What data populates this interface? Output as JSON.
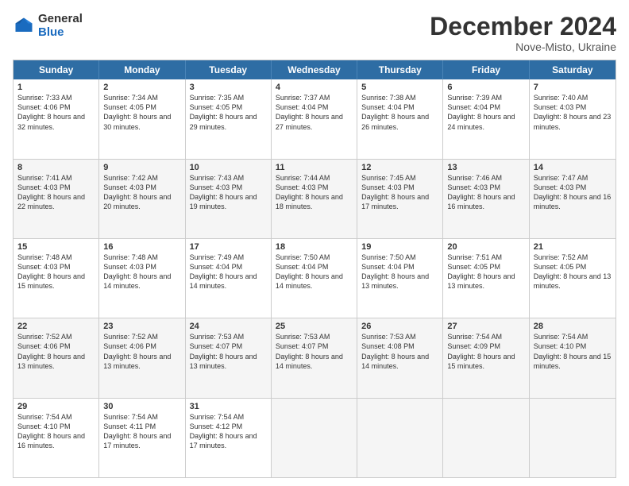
{
  "logo": {
    "general": "General",
    "blue": "Blue"
  },
  "title": "December 2024",
  "subtitle": "Nove-Misto, Ukraine",
  "days": [
    "Sunday",
    "Monday",
    "Tuesday",
    "Wednesday",
    "Thursday",
    "Friday",
    "Saturday"
  ],
  "weeks": [
    [
      {
        "day": 1,
        "rise": "7:33 AM",
        "set": "4:06 PM",
        "daylight": "8 hours and 32 minutes."
      },
      {
        "day": 2,
        "rise": "7:34 AM",
        "set": "4:05 PM",
        "daylight": "8 hours and 30 minutes."
      },
      {
        "day": 3,
        "rise": "7:35 AM",
        "set": "4:05 PM",
        "daylight": "8 hours and 29 minutes."
      },
      {
        "day": 4,
        "rise": "7:37 AM",
        "set": "4:04 PM",
        "daylight": "8 hours and 27 minutes."
      },
      {
        "day": 5,
        "rise": "7:38 AM",
        "set": "4:04 PM",
        "daylight": "8 hours and 26 minutes."
      },
      {
        "day": 6,
        "rise": "7:39 AM",
        "set": "4:04 PM",
        "daylight": "8 hours and 24 minutes."
      },
      {
        "day": 7,
        "rise": "7:40 AM",
        "set": "4:03 PM",
        "daylight": "8 hours and 23 minutes."
      }
    ],
    [
      {
        "day": 8,
        "rise": "7:41 AM",
        "set": "4:03 PM",
        "daylight": "8 hours and 22 minutes."
      },
      {
        "day": 9,
        "rise": "7:42 AM",
        "set": "4:03 PM",
        "daylight": "8 hours and 20 minutes."
      },
      {
        "day": 10,
        "rise": "7:43 AM",
        "set": "4:03 PM",
        "daylight": "8 hours and 19 minutes."
      },
      {
        "day": 11,
        "rise": "7:44 AM",
        "set": "4:03 PM",
        "daylight": "8 hours and 18 minutes."
      },
      {
        "day": 12,
        "rise": "7:45 AM",
        "set": "4:03 PM",
        "daylight": "8 hours and 17 minutes."
      },
      {
        "day": 13,
        "rise": "7:46 AM",
        "set": "4:03 PM",
        "daylight": "8 hours and 16 minutes."
      },
      {
        "day": 14,
        "rise": "7:47 AM",
        "set": "4:03 PM",
        "daylight": "8 hours and 16 minutes."
      }
    ],
    [
      {
        "day": 15,
        "rise": "7:48 AM",
        "set": "4:03 PM",
        "daylight": "8 hours and 15 minutes."
      },
      {
        "day": 16,
        "rise": "7:48 AM",
        "set": "4:03 PM",
        "daylight": "8 hours and 14 minutes."
      },
      {
        "day": 17,
        "rise": "7:49 AM",
        "set": "4:04 PM",
        "daylight": "8 hours and 14 minutes."
      },
      {
        "day": 18,
        "rise": "7:50 AM",
        "set": "4:04 PM",
        "daylight": "8 hours and 14 minutes."
      },
      {
        "day": 19,
        "rise": "7:50 AM",
        "set": "4:04 PM",
        "daylight": "8 hours and 13 minutes."
      },
      {
        "day": 20,
        "rise": "7:51 AM",
        "set": "4:05 PM",
        "daylight": "8 hours and 13 minutes."
      },
      {
        "day": 21,
        "rise": "7:52 AM",
        "set": "4:05 PM",
        "daylight": "8 hours and 13 minutes."
      }
    ],
    [
      {
        "day": 22,
        "rise": "7:52 AM",
        "set": "4:06 PM",
        "daylight": "8 hours and 13 minutes."
      },
      {
        "day": 23,
        "rise": "7:52 AM",
        "set": "4:06 PM",
        "daylight": "8 hours and 13 minutes."
      },
      {
        "day": 24,
        "rise": "7:53 AM",
        "set": "4:07 PM",
        "daylight": "8 hours and 13 minutes."
      },
      {
        "day": 25,
        "rise": "7:53 AM",
        "set": "4:07 PM",
        "daylight": "8 hours and 14 minutes."
      },
      {
        "day": 26,
        "rise": "7:53 AM",
        "set": "4:08 PM",
        "daylight": "8 hours and 14 minutes."
      },
      {
        "day": 27,
        "rise": "7:54 AM",
        "set": "4:09 PM",
        "daylight": "8 hours and 15 minutes."
      },
      {
        "day": 28,
        "rise": "7:54 AM",
        "set": "4:10 PM",
        "daylight": "8 hours and 15 minutes."
      }
    ],
    [
      {
        "day": 29,
        "rise": "7:54 AM",
        "set": "4:10 PM",
        "daylight": "8 hours and 16 minutes."
      },
      {
        "day": 30,
        "rise": "7:54 AM",
        "set": "4:11 PM",
        "daylight": "8 hours and 17 minutes."
      },
      {
        "day": 31,
        "rise": "7:54 AM",
        "set": "4:12 PM",
        "daylight": "8 hours and 17 minutes."
      },
      null,
      null,
      null,
      null
    ]
  ]
}
